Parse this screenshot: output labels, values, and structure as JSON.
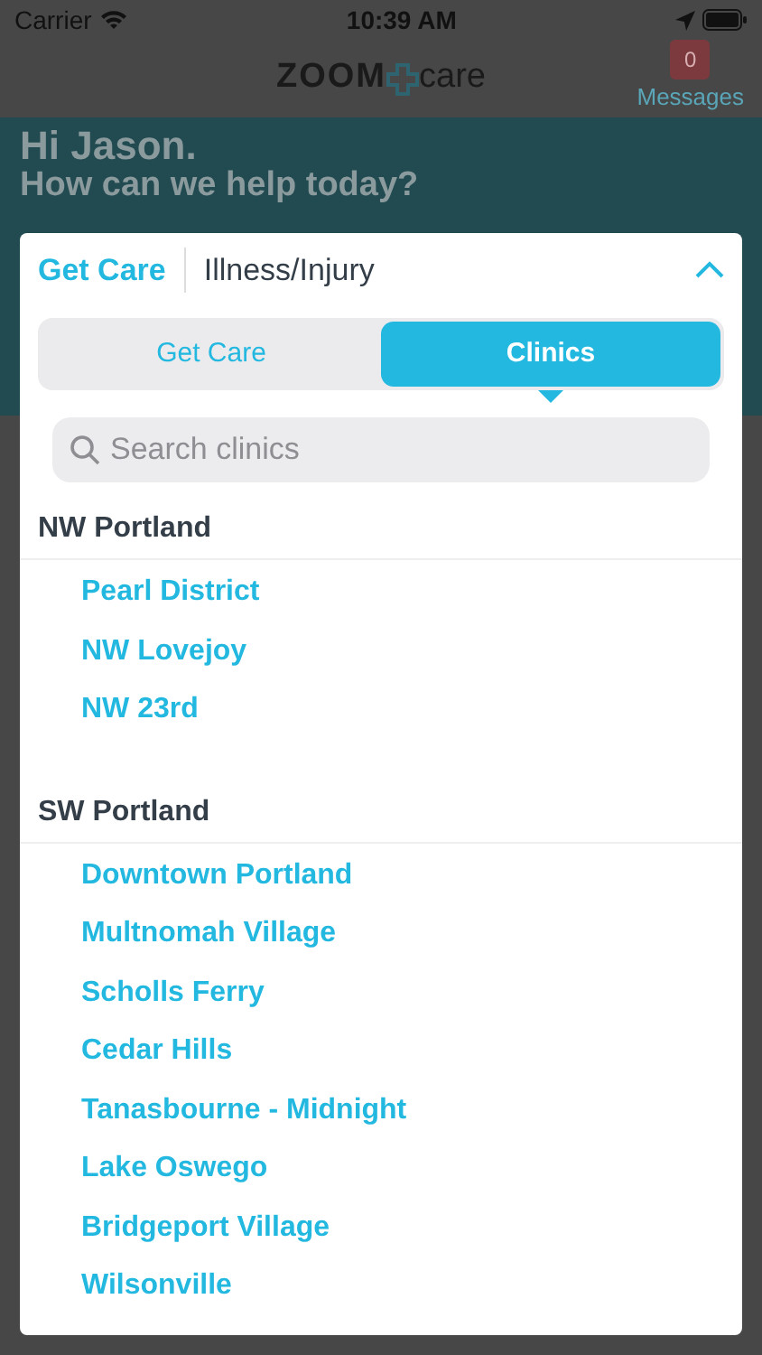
{
  "status_bar": {
    "carrier": "Carrier",
    "time": "10:39 AM"
  },
  "header": {
    "logo_left": "ZOOM",
    "logo_right": "care",
    "messages_count": "0",
    "messages_label": "Messages"
  },
  "greeting": {
    "title": "Hi Jason.",
    "subtitle": "How can we help today?"
  },
  "panel": {
    "breadcrumb": "Get Care",
    "current": "Illness/Injury",
    "expanded": true,
    "segments": [
      {
        "label": "Get Care",
        "selected": false
      },
      {
        "label": "Clinics",
        "selected": true
      }
    ],
    "search": {
      "placeholder": "Search clinics"
    },
    "sections": [
      {
        "title": "NW Portland",
        "clinics": [
          "Pearl District",
          "NW Lovejoy",
          "NW 23rd"
        ]
      },
      {
        "title": "SW Portland",
        "clinics": [
          "Downtown Portland",
          "Multnomah Village",
          "Scholls Ferry",
          "Cedar Hills",
          "Tanasbourne - Midnight",
          "Lake Oswego",
          "Bridgeport Village",
          "Wilsonville"
        ]
      }
    ]
  }
}
